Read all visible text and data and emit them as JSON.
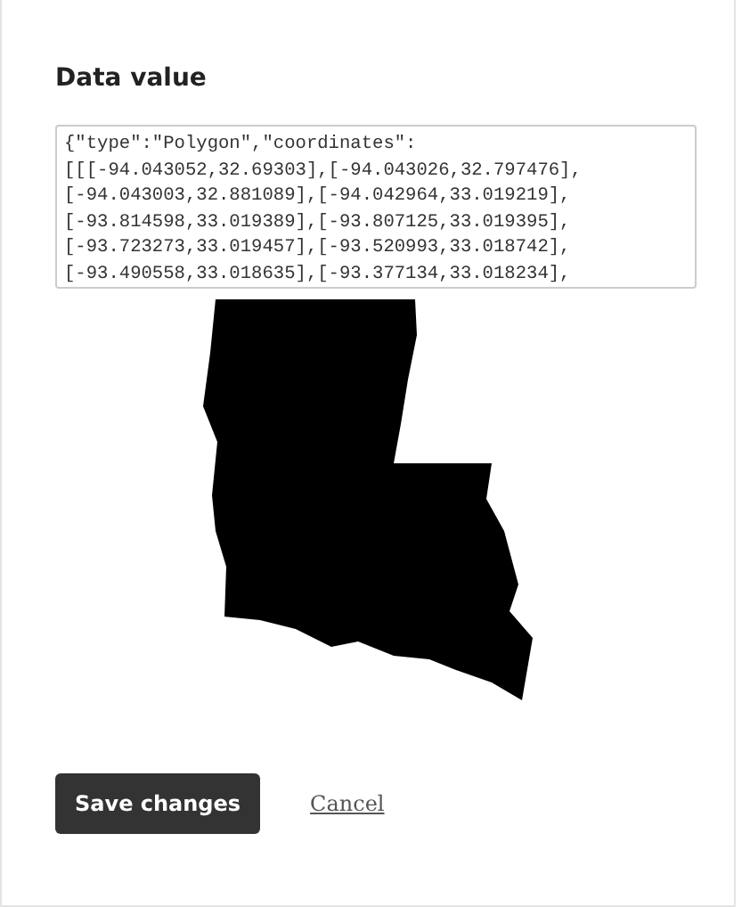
{
  "heading": "Data value",
  "data_field": {
    "value": "{\"type\":\"Polygon\",\"coordinates\":\n[[[-94.043052,32.69303],[-94.043026,32.797476],\n[-94.043003,32.881089],[-94.042964,33.019219],\n[-93.814598,33.019389],[-93.807125,33.019395],\n[-93.723273,33.019457],[-93.520993,33.018742],\n[-93.490558,33.018635],[-93.377134,33.018234],"
  },
  "buttons": [
    {
      "label": "Save changes",
      "kind": "primary"
    },
    {
      "label": "Cancel",
      "kind": "link"
    }
  ]
}
